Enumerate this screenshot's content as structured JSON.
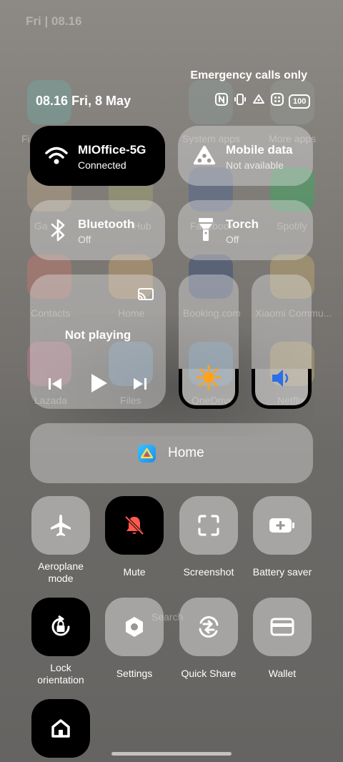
{
  "background": {
    "time_text": "Fri | 08.16",
    "apps": [
      {
        "label": "Fi",
        "color": "#6db3a8"
      },
      {
        "label": "System apps",
        "color": "#8fa3a0"
      },
      {
        "label": "More apps",
        "color": "#9aa09c"
      },
      {
        "label": "Ga",
        "color": "#c9b08a"
      },
      {
        "label": "Hub",
        "color": "#a8b36d"
      },
      {
        "label": "Facebook",
        "color": "#3b5998"
      },
      {
        "label": "Spotify",
        "color": "#1db954"
      },
      {
        "label": "Contacts",
        "color": "#d9776b"
      },
      {
        "label": "Home",
        "color": "#e1b36b"
      },
      {
        "label": "Booking.com",
        "color": "#1d3a7a"
      },
      {
        "label": "Xiaomi Commu...",
        "color": "#d9b86b"
      },
      {
        "label": "Lazada",
        "color": "#e07aa0"
      },
      {
        "label": "Files",
        "color": "#6fa8dc"
      },
      {
        "label": "OneDrive",
        "color": "#5fa0d8"
      },
      {
        "label": "Netflix",
        "color": "#d9b86b"
      }
    ],
    "search_text": "Search"
  },
  "status": {
    "network_text": "Emergency calls only",
    "datetime": "08.16 Fri, 8 May",
    "battery": "100"
  },
  "tiles": {
    "wifi": {
      "title": "MIOffice-5G",
      "subtitle": "Connected"
    },
    "mobile_data": {
      "title": "Mobile data",
      "subtitle": "Not available"
    },
    "bluetooth": {
      "title": "Bluetooth",
      "subtitle": "Off"
    },
    "torch": {
      "title": "Torch",
      "subtitle": "Off"
    }
  },
  "media": {
    "status": "Not playing"
  },
  "sliders": {
    "brightness_level": 0.3,
    "volume_level": 0.3
  },
  "smart_home": {
    "label": "Home"
  },
  "toggles": [
    {
      "label": "Aeroplane\nmode",
      "name": "aeroplane-mode",
      "icon": "airplane-icon",
      "active": false
    },
    {
      "label": "Mute",
      "name": "mute",
      "icon": "bell-off-icon",
      "active": true
    },
    {
      "label": "Screenshot",
      "name": "screenshot",
      "icon": "screenshot-icon",
      "active": false
    },
    {
      "label": "Battery saver",
      "name": "battery-saver",
      "icon": "battery-plus-icon",
      "active": false
    },
    {
      "label": "Lock\norientation",
      "name": "lock-orientation",
      "icon": "rotation-lock-icon",
      "active": true
    },
    {
      "label": "Settings",
      "name": "settings",
      "icon": "settings-hex-icon",
      "active": false
    },
    {
      "label": "Quick Share",
      "name": "quick-share",
      "icon": "quick-share-icon",
      "active": false
    },
    {
      "label": "Wallet",
      "name": "wallet",
      "icon": "wallet-icon",
      "active": false
    }
  ],
  "colors": {
    "accent_red": "#ff5a4e",
    "volume_blue": "#2d6fe8",
    "brightness_orange": "#ffa21a"
  }
}
